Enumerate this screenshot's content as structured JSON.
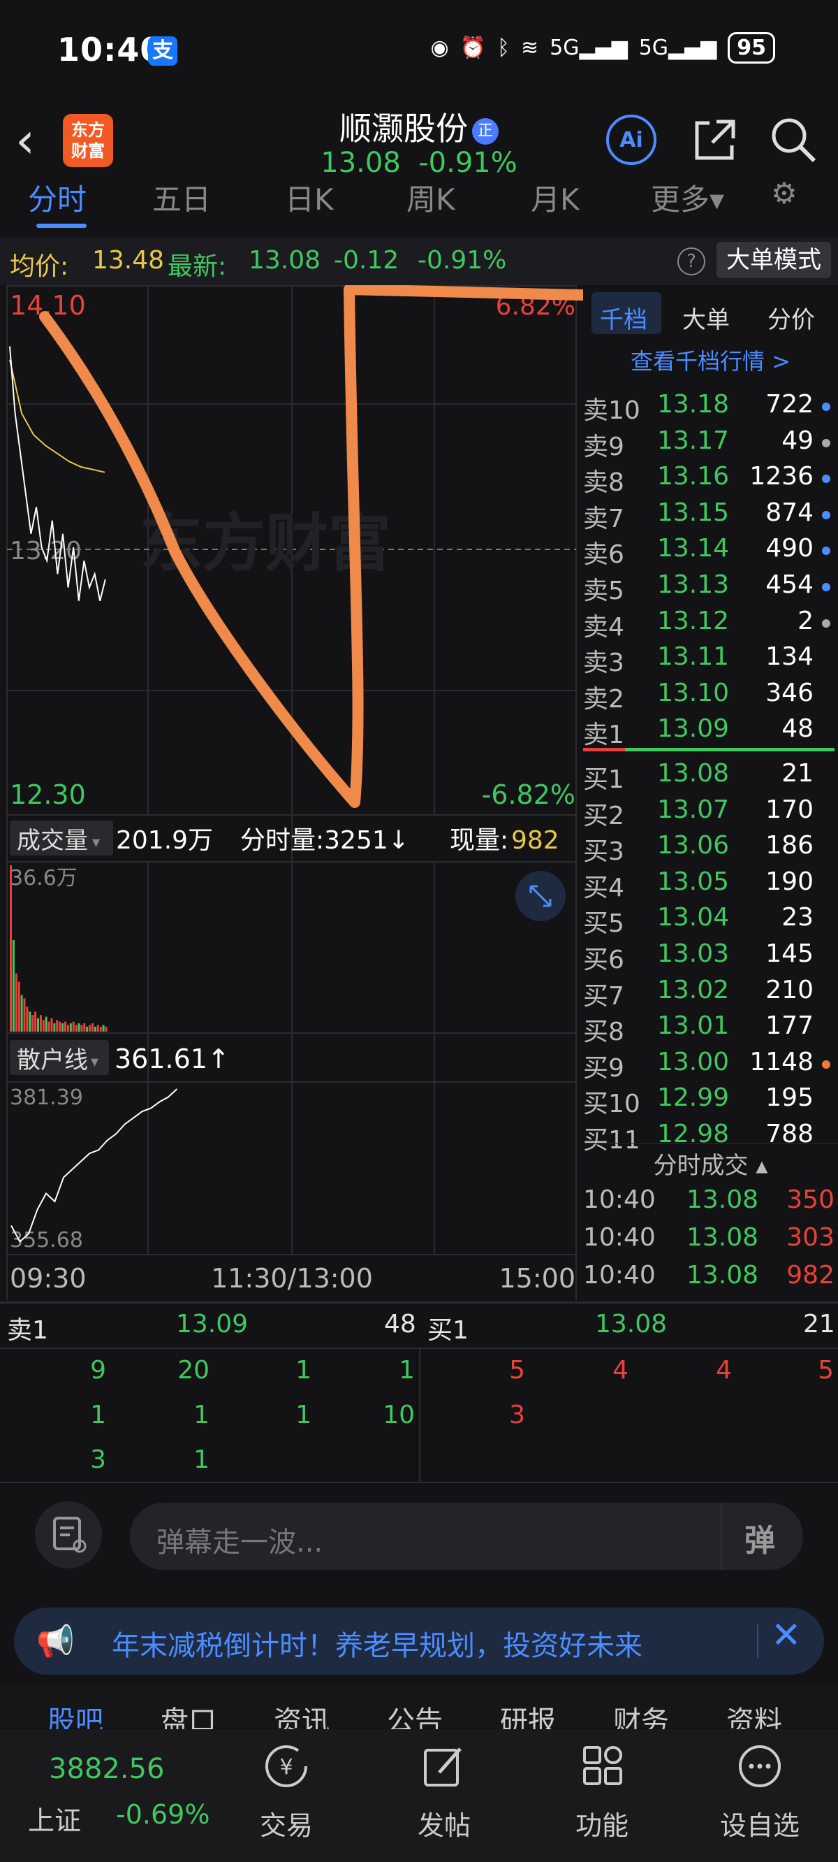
{
  "status_bar": {
    "time": "10:40",
    "battery": "95",
    "signal1": "5G",
    "signal2": "5G"
  },
  "header": {
    "app_logo": "东方\n财富",
    "stock_name": "顺灏股份",
    "badge": "正",
    "price": "13.08",
    "change_pct": "-0.91%"
  },
  "tabs": [
    "分时",
    "五日",
    "日K",
    "周K",
    "月K",
    "更多▾"
  ],
  "info_bar": {
    "avg_label": "均价:",
    "avg_value": "13.48",
    "last_label": "最新:",
    "last_value": "13.08",
    "change": "-0.12",
    "change_pct": "-0.91%",
    "mode_button": "大单模式"
  },
  "chart_data": [
    {
      "type": "line",
      "series": [],
      "y_top": "14.10",
      "y_mid": "13.20",
      "y_bottom": "12.30",
      "pct_top": "6.82%",
      "pct_bottom": "-6.82%",
      "price_points": [
        13.95,
        13.7,
        13.55,
        13.4,
        13.25,
        13.35,
        13.2,
        13.15,
        13.3,
        13.1,
        13.25,
        13.05,
        13.2,
        13.0,
        13.15,
        13.05,
        13.1,
        13.0,
        13.08
      ],
      "avg_points": [
        13.9,
        13.7,
        13.62,
        13.58,
        13.55,
        13.52,
        13.5,
        13.49,
        13.48
      ],
      "watermark": "东方财富"
    },
    {
      "type": "bar",
      "label": "成交量",
      "total": "201.9万",
      "tick_label": "分时量:3251↓",
      "current_label": "现量:",
      "current_value": "982",
      "ymax_label": "36.6万"
    },
    {
      "type": "line",
      "label": "散户线",
      "value": "361.61↑",
      "ymax_label": "381.39",
      "ymin_label": "355.68",
      "x_labels": [
        "09:30",
        "11:30/13:00",
        "15:00"
      ]
    }
  ],
  "right_panel": {
    "tabs": [
      "千档",
      "大单",
      "分价"
    ],
    "link": "查看千档行情 >",
    "asks": [
      {
        "label": "卖10",
        "price": "13.18",
        "vol": "722",
        "dot": "#4b8cff"
      },
      {
        "label": "卖9",
        "price": "13.17",
        "vol": "49",
        "dot": "#aaaaaa"
      },
      {
        "label": "卖8",
        "price": "13.16",
        "vol": "1236",
        "dot": "#4b8cff"
      },
      {
        "label": "卖7",
        "price": "13.15",
        "vol": "874",
        "dot": "#4b8cff"
      },
      {
        "label": "卖6",
        "price": "13.14",
        "vol": "490",
        "dot": "#4b8cff"
      },
      {
        "label": "卖5",
        "price": "13.13",
        "vol": "454",
        "dot": "#4b8cff"
      },
      {
        "label": "卖4",
        "price": "13.12",
        "vol": "2",
        "dot": "#aaaaaa"
      },
      {
        "label": "卖3",
        "price": "13.11",
        "vol": "134",
        "dot": ""
      },
      {
        "label": "卖2",
        "price": "13.10",
        "vol": "346",
        "dot": ""
      },
      {
        "label": "卖1",
        "price": "13.09",
        "vol": "48",
        "dot": ""
      }
    ],
    "bids": [
      {
        "label": "买1",
        "price": "13.08",
        "vol": "21",
        "dot": ""
      },
      {
        "label": "买2",
        "price": "13.07",
        "vol": "170",
        "dot": ""
      },
      {
        "label": "买3",
        "price": "13.06",
        "vol": "186",
        "dot": ""
      },
      {
        "label": "买4",
        "price": "13.05",
        "vol": "190",
        "dot": ""
      },
      {
        "label": "买5",
        "price": "13.04",
        "vol": "23",
        "dot": ""
      },
      {
        "label": "买6",
        "price": "13.03",
        "vol": "145",
        "dot": ""
      },
      {
        "label": "买7",
        "price": "13.02",
        "vol": "210",
        "dot": ""
      },
      {
        "label": "买8",
        "price": "13.01",
        "vol": "177",
        "dot": ""
      },
      {
        "label": "买9",
        "price": "13.00",
        "vol": "1148",
        "dot": "#f07a3a"
      },
      {
        "label": "买10",
        "price": "12.99",
        "vol": "195",
        "dot": ""
      },
      {
        "label": "买11",
        "price": "12.98",
        "vol": "788",
        "dot": ""
      }
    ],
    "trades_title": "分时成交",
    "trades": [
      {
        "time": "10:40",
        "price": "13.08",
        "vol": "350"
      },
      {
        "time": "10:40",
        "price": "13.08",
        "vol": "303"
      },
      {
        "time": "10:40",
        "price": "13.08",
        "vol": "982"
      }
    ]
  },
  "queue": {
    "ask_label": "卖1",
    "ask_price": "13.09",
    "ask_total": "48",
    "bid_label": "买1",
    "bid_price": "13.08",
    "bid_total": "21",
    "ask_orders": [
      "9",
      "20",
      "1",
      "1",
      "1",
      "1",
      "1",
      "10",
      "3",
      "1"
    ],
    "bid_orders": [
      "5",
      "4",
      "4",
      "5",
      "3"
    ]
  },
  "comment": {
    "placeholder": "弹幕走一波...",
    "danmu_button": "弹"
  },
  "banner": {
    "text": "年末减税倒计时！养老早规划，投资好未来"
  },
  "bottom_tabs": [
    "股吧",
    "盘口",
    "资讯",
    "公告",
    "研报",
    "财务",
    "资料"
  ],
  "index": {
    "value": "3882.56",
    "name": "上证",
    "change": "-0.69%"
  },
  "toolbar": [
    {
      "label": "交易",
      "icon": "yuan-icon"
    },
    {
      "label": "发帖",
      "icon": "edit-icon"
    },
    {
      "label": "功能",
      "icon": "grid-icon"
    },
    {
      "label": "设自选",
      "icon": "more-icon"
    }
  ]
}
